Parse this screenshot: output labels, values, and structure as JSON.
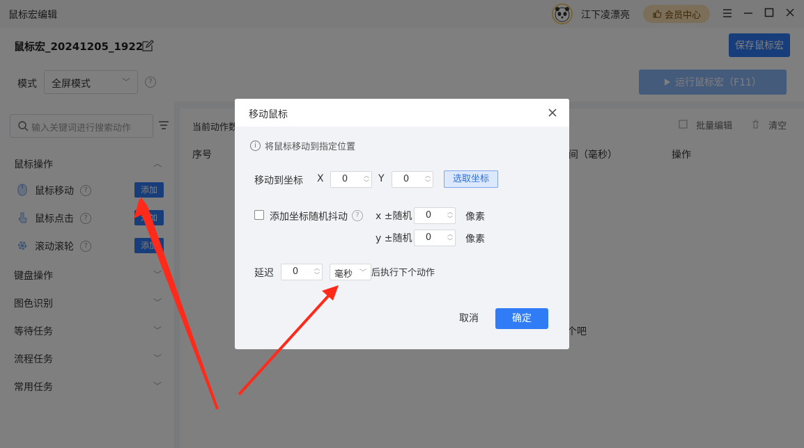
{
  "app": {
    "title": "鼠标宏编辑",
    "user_name": "江下凌漂亮",
    "vip_label": "会员中心"
  },
  "macro": {
    "name": "鼠标宏_20241205_1922",
    "save_label": "保存鼠标宏"
  },
  "mode": {
    "label": "模式",
    "value": "全屏模式"
  },
  "run": {
    "label": "运行鼠标宏（F11）"
  },
  "sidebar": {
    "search_placeholder": "输入关键词进行搜索动作",
    "categories": [
      {
        "label": "鼠标操作",
        "items": [
          {
            "label": "鼠标移动",
            "add": "添加"
          },
          {
            "label": "鼠标点击",
            "add": "添加"
          },
          {
            "label": "滚动滚轮",
            "add": "添加"
          }
        ]
      },
      {
        "label": "键盘操作"
      },
      {
        "label": "图色识别"
      },
      {
        "label": "等待任务"
      },
      {
        "label": "流程任务"
      },
      {
        "label": "常用任务"
      }
    ]
  },
  "main": {
    "current_label": "当前动作数",
    "batch_edit": "批量编辑",
    "clear": "清空",
    "headers": {
      "index": "序号",
      "time": "间（毫秒）",
      "action": "操作"
    },
    "empty_tail": "个吧"
  },
  "dialog": {
    "title": "移动鼠标",
    "info": "将鼠标移动到指定位置",
    "move_to_label": "移动到坐标",
    "x_label": "X",
    "x_value": "0",
    "y_label": "Y",
    "y_value": "0",
    "pick_label": "选取坐标",
    "jitter_label": "添加坐标随机抖动",
    "x_rand_label": "x ±随机",
    "x_rand_value": "0",
    "y_rand_label": "y ±随机",
    "y_rand_value": "0",
    "pixel_unit": "像素",
    "delay_label": "延迟",
    "delay_value": "0",
    "delay_unit": "毫秒",
    "delay_suffix": "后执行下个动作",
    "cancel_label": "取消",
    "ok_label": "确定"
  },
  "colors": {
    "accent": "#2f7cf6",
    "arrow": "#ff2a1a"
  }
}
